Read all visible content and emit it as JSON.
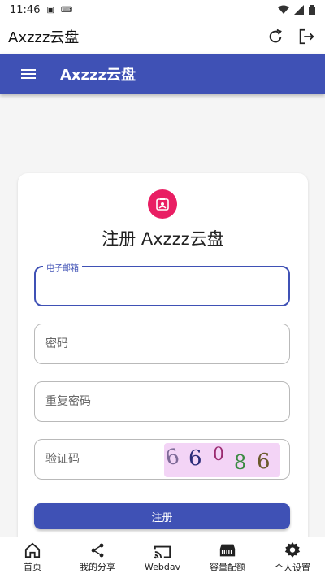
{
  "status_bar": {
    "time": "11:46",
    "icons": [
      "a-icon",
      "keyboard-icon",
      "wifi-icon",
      "signal-icon",
      "battery-icon"
    ]
  },
  "app_bar": {
    "title": "Axzzz云盘"
  },
  "toolbar": {
    "brand": "Axzzz云盘"
  },
  "form": {
    "title": "注册 Axzzz云盘",
    "email_label": "电子邮箱",
    "email_value": "",
    "password_placeholder": "密码",
    "repeat_password_placeholder": "重复密码",
    "captcha_placeholder": "验证码",
    "captcha_text": [
      "6",
      "6",
      "0",
      "8",
      "6"
    ],
    "submit_label": "注册"
  },
  "bottom_nav": [
    {
      "label": "首页",
      "icon": "home-icon"
    },
    {
      "label": "我的分享",
      "icon": "share-icon"
    },
    {
      "label": "Webdav",
      "icon": "cast-icon"
    },
    {
      "label": "容量配额",
      "icon": "storage-icon"
    },
    {
      "label": "个人设置",
      "icon": "settings-icon"
    }
  ],
  "colors": {
    "primary": "#3f51b5",
    "accent": "#e91e63"
  }
}
